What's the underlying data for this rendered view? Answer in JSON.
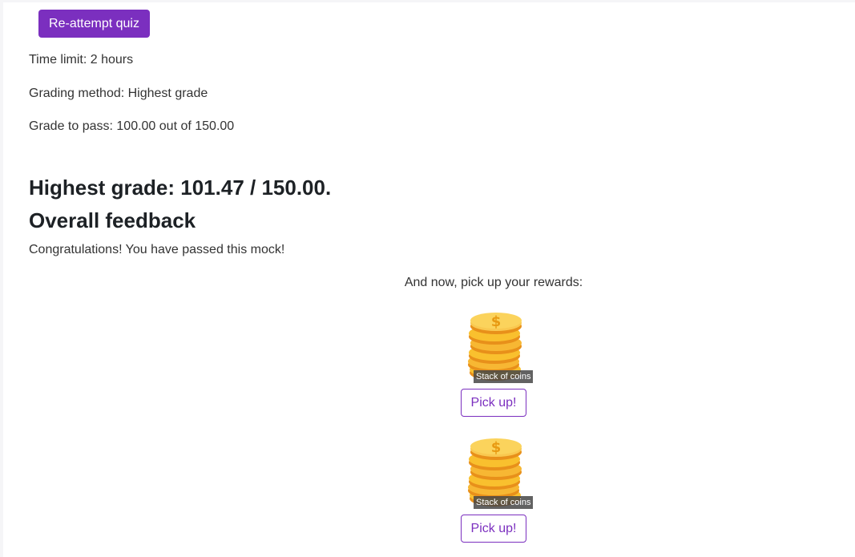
{
  "actions": {
    "reattempt_label": "Re-attempt quiz"
  },
  "quiz_info": {
    "time_limit": "Time limit: 2 hours",
    "grading_method": "Grading method: Highest grade",
    "grade_to_pass": "Grade to pass: 100.00 out of 150.00"
  },
  "result": {
    "highest_grade": "Highest grade: 101.47 / 150.00.",
    "feedback_heading": "Overall feedback",
    "feedback_text": "Congratulations! You have passed this mock!"
  },
  "rewards": {
    "intro": "And now, pick up your rewards:",
    "items": [
      {
        "image_label": "Stack of coins",
        "icon": "coin-stack-icon",
        "button_label": "Pick up!"
      },
      {
        "image_label": "Stack of coins",
        "icon": "coin-stack-icon",
        "button_label": "Pick up!"
      }
    ]
  },
  "colors": {
    "accent": "#7b2fbf",
    "heading": "#1d2125",
    "text": "#333333",
    "coin_gold": "#f9c02e",
    "coin_orange": "#f5a623"
  }
}
